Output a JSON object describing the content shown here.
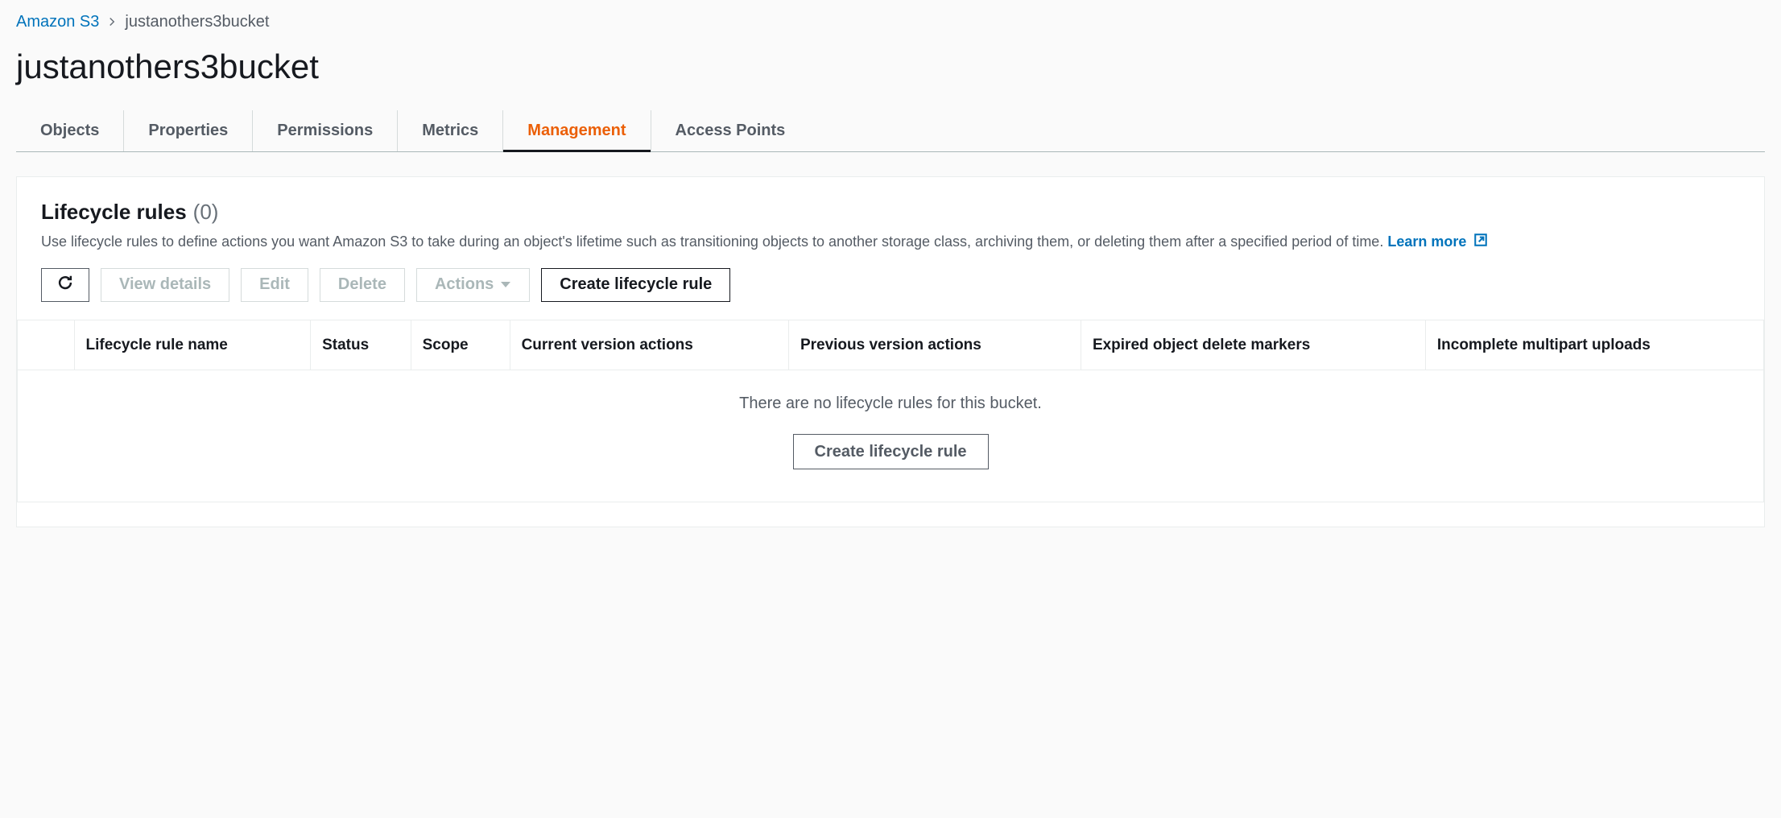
{
  "breadcrumb": {
    "root": "Amazon S3",
    "current": "justanothers3bucket"
  },
  "page_title": "justanothers3bucket",
  "tabs": [
    {
      "label": "Objects",
      "active": false
    },
    {
      "label": "Properties",
      "active": false
    },
    {
      "label": "Permissions",
      "active": false
    },
    {
      "label": "Metrics",
      "active": false
    },
    {
      "label": "Management",
      "active": true
    },
    {
      "label": "Access Points",
      "active": false
    }
  ],
  "panel": {
    "title": "Lifecycle rules",
    "count": "(0)",
    "description": "Use lifecycle rules to define actions you want Amazon S3 to take during an object's lifetime such as transitioning objects to another storage class, archiving them, or deleting them after a specified period of time.",
    "learn_more": "Learn more"
  },
  "toolbar": {
    "view_details": "View details",
    "edit": "Edit",
    "delete": "Delete",
    "actions": "Actions",
    "create": "Create lifecycle rule"
  },
  "table": {
    "headers": [
      "Lifecycle rule name",
      "Status",
      "Scope",
      "Current version actions",
      "Previous version actions",
      "Expired object delete markers",
      "Incomplete multipart uploads"
    ],
    "empty_message": "There are no lifecycle rules for this bucket.",
    "empty_cta": "Create lifecycle rule"
  }
}
